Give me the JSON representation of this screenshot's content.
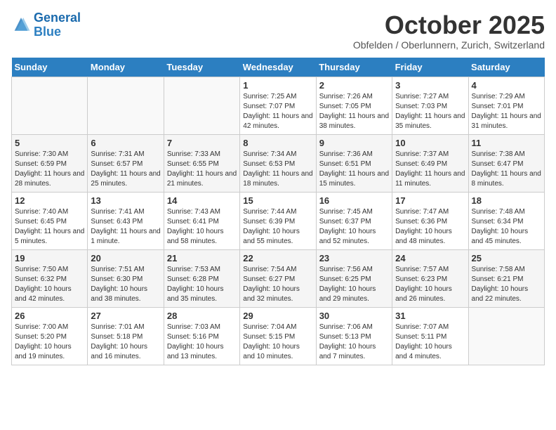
{
  "header": {
    "logo_line1": "General",
    "logo_line2": "Blue",
    "month_title": "October 2025",
    "subtitle": "Obfelden / Oberlunnern, Zurich, Switzerland"
  },
  "days_of_week": [
    "Sunday",
    "Monday",
    "Tuesday",
    "Wednesday",
    "Thursday",
    "Friday",
    "Saturday"
  ],
  "weeks": [
    [
      {
        "day": "",
        "sunrise": "",
        "sunset": "",
        "daylight": ""
      },
      {
        "day": "",
        "sunrise": "",
        "sunset": "",
        "daylight": ""
      },
      {
        "day": "",
        "sunrise": "",
        "sunset": "",
        "daylight": ""
      },
      {
        "day": "1",
        "sunrise": "Sunrise: 7:25 AM",
        "sunset": "Sunset: 7:07 PM",
        "daylight": "Daylight: 11 hours and 42 minutes."
      },
      {
        "day": "2",
        "sunrise": "Sunrise: 7:26 AM",
        "sunset": "Sunset: 7:05 PM",
        "daylight": "Daylight: 11 hours and 38 minutes."
      },
      {
        "day": "3",
        "sunrise": "Sunrise: 7:27 AM",
        "sunset": "Sunset: 7:03 PM",
        "daylight": "Daylight: 11 hours and 35 minutes."
      },
      {
        "day": "4",
        "sunrise": "Sunrise: 7:29 AM",
        "sunset": "Sunset: 7:01 PM",
        "daylight": "Daylight: 11 hours and 31 minutes."
      }
    ],
    [
      {
        "day": "5",
        "sunrise": "Sunrise: 7:30 AM",
        "sunset": "Sunset: 6:59 PM",
        "daylight": "Daylight: 11 hours and 28 minutes."
      },
      {
        "day": "6",
        "sunrise": "Sunrise: 7:31 AM",
        "sunset": "Sunset: 6:57 PM",
        "daylight": "Daylight: 11 hours and 25 minutes."
      },
      {
        "day": "7",
        "sunrise": "Sunrise: 7:33 AM",
        "sunset": "Sunset: 6:55 PM",
        "daylight": "Daylight: 11 hours and 21 minutes."
      },
      {
        "day": "8",
        "sunrise": "Sunrise: 7:34 AM",
        "sunset": "Sunset: 6:53 PM",
        "daylight": "Daylight: 11 hours and 18 minutes."
      },
      {
        "day": "9",
        "sunrise": "Sunrise: 7:36 AM",
        "sunset": "Sunset: 6:51 PM",
        "daylight": "Daylight: 11 hours and 15 minutes."
      },
      {
        "day": "10",
        "sunrise": "Sunrise: 7:37 AM",
        "sunset": "Sunset: 6:49 PM",
        "daylight": "Daylight: 11 hours and 11 minutes."
      },
      {
        "day": "11",
        "sunrise": "Sunrise: 7:38 AM",
        "sunset": "Sunset: 6:47 PM",
        "daylight": "Daylight: 11 hours and 8 minutes."
      }
    ],
    [
      {
        "day": "12",
        "sunrise": "Sunrise: 7:40 AM",
        "sunset": "Sunset: 6:45 PM",
        "daylight": "Daylight: 11 hours and 5 minutes."
      },
      {
        "day": "13",
        "sunrise": "Sunrise: 7:41 AM",
        "sunset": "Sunset: 6:43 PM",
        "daylight": "Daylight: 11 hours and 1 minute."
      },
      {
        "day": "14",
        "sunrise": "Sunrise: 7:43 AM",
        "sunset": "Sunset: 6:41 PM",
        "daylight": "Daylight: 10 hours and 58 minutes."
      },
      {
        "day": "15",
        "sunrise": "Sunrise: 7:44 AM",
        "sunset": "Sunset: 6:39 PM",
        "daylight": "Daylight: 10 hours and 55 minutes."
      },
      {
        "day": "16",
        "sunrise": "Sunrise: 7:45 AM",
        "sunset": "Sunset: 6:37 PM",
        "daylight": "Daylight: 10 hours and 52 minutes."
      },
      {
        "day": "17",
        "sunrise": "Sunrise: 7:47 AM",
        "sunset": "Sunset: 6:36 PM",
        "daylight": "Daylight: 10 hours and 48 minutes."
      },
      {
        "day": "18",
        "sunrise": "Sunrise: 7:48 AM",
        "sunset": "Sunset: 6:34 PM",
        "daylight": "Daylight: 10 hours and 45 minutes."
      }
    ],
    [
      {
        "day": "19",
        "sunrise": "Sunrise: 7:50 AM",
        "sunset": "Sunset: 6:32 PM",
        "daylight": "Daylight: 10 hours and 42 minutes."
      },
      {
        "day": "20",
        "sunrise": "Sunrise: 7:51 AM",
        "sunset": "Sunset: 6:30 PM",
        "daylight": "Daylight: 10 hours and 38 minutes."
      },
      {
        "day": "21",
        "sunrise": "Sunrise: 7:53 AM",
        "sunset": "Sunset: 6:28 PM",
        "daylight": "Daylight: 10 hours and 35 minutes."
      },
      {
        "day": "22",
        "sunrise": "Sunrise: 7:54 AM",
        "sunset": "Sunset: 6:27 PM",
        "daylight": "Daylight: 10 hours and 32 minutes."
      },
      {
        "day": "23",
        "sunrise": "Sunrise: 7:56 AM",
        "sunset": "Sunset: 6:25 PM",
        "daylight": "Daylight: 10 hours and 29 minutes."
      },
      {
        "day": "24",
        "sunrise": "Sunrise: 7:57 AM",
        "sunset": "Sunset: 6:23 PM",
        "daylight": "Daylight: 10 hours and 26 minutes."
      },
      {
        "day": "25",
        "sunrise": "Sunrise: 7:58 AM",
        "sunset": "Sunset: 6:21 PM",
        "daylight": "Daylight: 10 hours and 22 minutes."
      }
    ],
    [
      {
        "day": "26",
        "sunrise": "Sunrise: 7:00 AM",
        "sunset": "Sunset: 5:20 PM",
        "daylight": "Daylight: 10 hours and 19 minutes."
      },
      {
        "day": "27",
        "sunrise": "Sunrise: 7:01 AM",
        "sunset": "Sunset: 5:18 PM",
        "daylight": "Daylight: 10 hours and 16 minutes."
      },
      {
        "day": "28",
        "sunrise": "Sunrise: 7:03 AM",
        "sunset": "Sunset: 5:16 PM",
        "daylight": "Daylight: 10 hours and 13 minutes."
      },
      {
        "day": "29",
        "sunrise": "Sunrise: 7:04 AM",
        "sunset": "Sunset: 5:15 PM",
        "daylight": "Daylight: 10 hours and 10 minutes."
      },
      {
        "day": "30",
        "sunrise": "Sunrise: 7:06 AM",
        "sunset": "Sunset: 5:13 PM",
        "daylight": "Daylight: 10 hours and 7 minutes."
      },
      {
        "day": "31",
        "sunrise": "Sunrise: 7:07 AM",
        "sunset": "Sunset: 5:11 PM",
        "daylight": "Daylight: 10 hours and 4 minutes."
      },
      {
        "day": "",
        "sunrise": "",
        "sunset": "",
        "daylight": ""
      }
    ]
  ]
}
